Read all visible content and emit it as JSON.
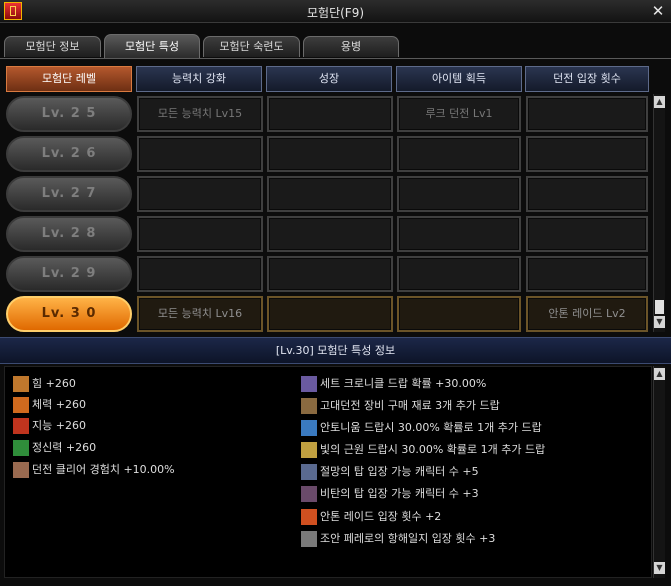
{
  "window": {
    "title": "모험단(F9)"
  },
  "tabs": [
    {
      "label": "모험단 정보"
    },
    {
      "label": "모험단 특성"
    },
    {
      "label": "모험단 숙련도"
    },
    {
      "label": "용병"
    }
  ],
  "table": {
    "headers": [
      "모험단 레벨",
      "능력치 강화",
      "성장",
      "아이템 획득",
      "던전 입장 횟수"
    ],
    "rows": [
      {
        "level": "Lv. 2 5",
        "cells": [
          "모든 능력치 Lv15",
          "",
          "루크 던전 Lv1",
          ""
        ],
        "active": false
      },
      {
        "level": "Lv. 2 6",
        "cells": [
          "",
          "",
          "",
          ""
        ],
        "active": false
      },
      {
        "level": "Lv. 2 7",
        "cells": [
          "",
          "",
          "",
          ""
        ],
        "active": false
      },
      {
        "level": "Lv. 2 8",
        "cells": [
          "",
          "",
          "",
          ""
        ],
        "active": false
      },
      {
        "level": "Lv. 2 9",
        "cells": [
          "",
          "",
          "",
          ""
        ],
        "active": false
      },
      {
        "level": "Lv. 3 0",
        "cells": [
          "모든 능력치 Lv16",
          "",
          "",
          "안톤 레이드 Lv2"
        ],
        "active": true
      }
    ]
  },
  "info": {
    "title": "[Lv.30] 모험단 특성 정보",
    "left": [
      {
        "icon": "strength-icon",
        "text": "힘 +260",
        "color": "#c0782d"
      },
      {
        "icon": "vitality-icon",
        "text": "체력 +260",
        "color": "#d06a1e"
      },
      {
        "icon": "intelligence-icon",
        "text": "지능 +260",
        "color": "#c0341e"
      },
      {
        "icon": "spirit-icon",
        "text": "정신력 +260",
        "color": "#2f8d3a"
      },
      {
        "icon": "dungeon-clear-icon",
        "text": "던전 클리어 경험치 +10.00%",
        "color": "#9a6a50"
      }
    ],
    "right": [
      {
        "icon": "chronicle-icon",
        "text": "세트 크로니클 드랍 확률 +30.00%",
        "color": "#6a5aa0"
      },
      {
        "icon": "ancient-dungeon-icon",
        "text": "고대던전 장비 구매 재료 3개 추가 드랍",
        "color": "#8a6a40"
      },
      {
        "icon": "antonium-icon",
        "text": "안토니움 드랍시 30.00% 확률로 1개 추가 드랍",
        "color": "#3a7ac0"
      },
      {
        "icon": "light-origin-icon",
        "text": "빛의 근원 드랍시 30.00% 확률로 1개 추가 드랍",
        "color": "#c0a040"
      },
      {
        "icon": "despair-tower-icon",
        "text": "절망의 탑 입장 가능 캐릭터 수 +5",
        "color": "#5a6a90"
      },
      {
        "icon": "tower-icon",
        "text": "비탄의 탑 입장 가능 캐릭터 수 +3",
        "color": "#6a4a6a"
      },
      {
        "icon": "anton-raid-icon",
        "text": "안톤 레이드 입장 횟수 +2",
        "color": "#d05020"
      },
      {
        "icon": "diary-icon",
        "text": "조안 페레로의 항해일지 입장 횟수 +3",
        "color": "#7a7a7a"
      }
    ]
  }
}
